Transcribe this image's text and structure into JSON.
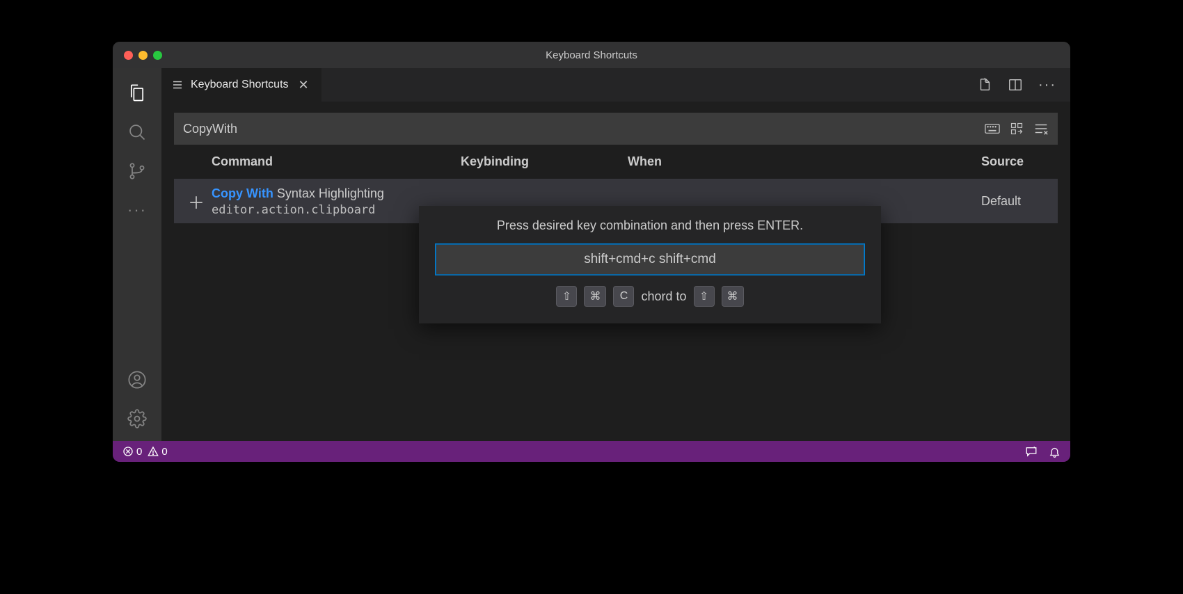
{
  "titlebar": {
    "title": "Keyboard Shortcuts"
  },
  "tab": {
    "label": "Keyboard Shortcuts"
  },
  "search": {
    "value": "CopyWith"
  },
  "columns": {
    "command": "Command",
    "keybinding": "Keybinding",
    "when": "When",
    "source": "Source"
  },
  "rows": [
    {
      "title_highlight": "Copy With",
      "title_rest": " Syntax Highlighting",
      "command_id": "editor.action.clipboard",
      "keybinding": "",
      "when": "",
      "source": "Default"
    }
  ],
  "dialog": {
    "instruction": "Press desired key combination and then press ENTER.",
    "input_value": "shift+cmd+c shift+cmd",
    "chord_keys_left": [
      "⇧",
      "⌘",
      "C"
    ],
    "chord_label": "chord to",
    "chord_keys_right": [
      "⇧",
      "⌘"
    ]
  },
  "statusbar": {
    "errors": "0",
    "warnings": "0"
  }
}
